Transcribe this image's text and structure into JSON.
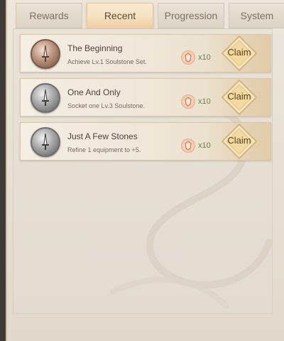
{
  "tabs": [
    {
      "label": "Rewards",
      "active": false
    },
    {
      "label": "Recent",
      "active": true
    },
    {
      "label": "Progression",
      "active": false
    },
    {
      "label": "System",
      "active": false
    }
  ],
  "achievements": [
    {
      "title": "The Beginning",
      "description": "Achieve Lv.1 Soulstone Set.",
      "medal": "bronze-sword-medal",
      "reward_icon": "emblem-icon",
      "reward_qty": "x10",
      "claim_label": "Claim"
    },
    {
      "title": "One And Only",
      "description": "Socket one Lv.3 Soulstone.",
      "medal": "silver-sword-medal",
      "reward_icon": "emblem-icon",
      "reward_qty": "x10",
      "claim_label": "Claim"
    },
    {
      "title": "Just A Few Stones",
      "description": "Refine 1 equipment to +5.",
      "medal": "silver-sword-medal",
      "reward_icon": "emblem-icon",
      "reward_qty": "x10",
      "claim_label": "Claim"
    }
  ],
  "colors": {
    "accent_tab": "#f5dfbd",
    "claim_gold": "#f3d9a0",
    "qty_green": "#4f8e3f"
  }
}
